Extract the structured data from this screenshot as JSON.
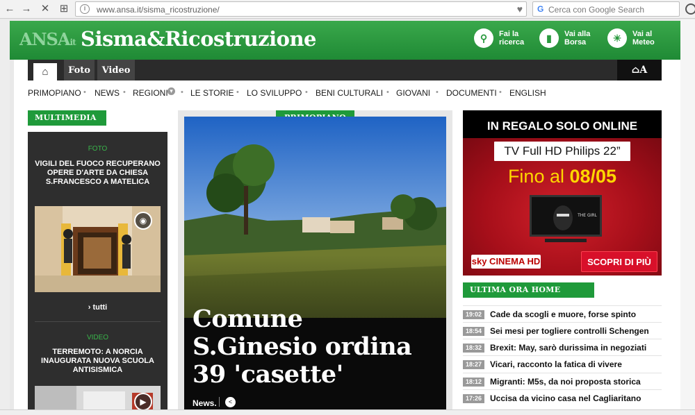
{
  "browser": {
    "url_host": "www.ansa.it",
    "url_path": "/sisma_ricostruzione/",
    "search_placeholder": "Cerca con Google Search",
    "search_engine_letter": "G",
    "back_glyph": "←",
    "forward_glyph": "→",
    "stop_glyph": "✕",
    "apps_glyph": "⊞",
    "info_glyph": "i",
    "bookmark_glyph": "♥"
  },
  "header": {
    "logo_brand": "ANSA",
    "logo_suffix": "it",
    "site_title": "Sisma&Ricostruzione",
    "actions": [
      {
        "line1": "Fai la",
        "line2": "ricerca",
        "icon": "search-icon",
        "glyph": "⚲"
      },
      {
        "line1": "Vai alla",
        "line2": "Borsa",
        "icon": "chart-icon",
        "glyph": "▮"
      },
      {
        "line1": "Vai al",
        "line2": "Meteo",
        "icon": "weather-icon",
        "glyph": "☀"
      }
    ]
  },
  "topnav": {
    "home_glyph": "⌂",
    "foto": "Foto",
    "video": "Video",
    "right_label": "⌂A"
  },
  "menu": {
    "items": [
      "PRIMOPIANO",
      "NEWS",
      "REGIONI",
      "LE STORIE",
      "LO SVILUPPO",
      "BENI CULTURALI",
      "GIOVANI",
      "DOCUMENTI",
      "ENGLISH"
    ],
    "separator": "•",
    "expand_glyph": "▾"
  },
  "multimedia": {
    "label": "MULTIMEDIA",
    "item1": {
      "category": "FOTO",
      "title": "VIGILI DEL FUOCO RECUPERANO OPERE D'ARTE DA CHIESA S.FRANCESCO A MATELICA",
      "camera_glyph": "◉"
    },
    "tutti": "› tutti",
    "item2": {
      "category": "VIDEO",
      "title": "TERREMOTO: A NORCIA INAUGURATA NUOVA SCUOLA ANTISISMICA",
      "video_glyph": "▶"
    }
  },
  "main": {
    "label": "PRIMOPIANO",
    "title_lines": [
      "Comune",
      "S.Ginesio ordina",
      "39 'casette'"
    ],
    "source": "News.",
    "share_glyph": "<"
  },
  "ad": {
    "top": "IN REGALO SOLO ONLINE",
    "product": "TV Full HD Philips 22”",
    "date_prefix": "Fino al ",
    "date": "08/05",
    "brand": "sky CINEMA HD",
    "cta": "SCOPRI DI PIÙ",
    "tv_text": "THE GIRL"
  },
  "ultima_ora": {
    "label": "ULTIMA ORA HOME",
    "items": [
      {
        "time": "19:02",
        "text": "Cade da scogli e muore, forse spinto"
      },
      {
        "time": "18:54",
        "text": "Sei mesi per togliere controlli Schengen"
      },
      {
        "time": "18:32",
        "text": "Brexit: May, sarò durissima in negoziati"
      },
      {
        "time": "18:27",
        "text": "Vicari, racconto la fatica di vivere"
      },
      {
        "time": "18:12",
        "text": "Migranti: M5s, da noi proposta storica"
      },
      {
        "time": "17:26",
        "text": "Uccisa da vicino casa nel Cagliaritano"
      }
    ]
  },
  "colors": {
    "brand_green": "#1f9a3a",
    "header_green": "#2b9a40",
    "ad_red": "#d0202a",
    "ad_yellow": "#ffd700"
  }
}
